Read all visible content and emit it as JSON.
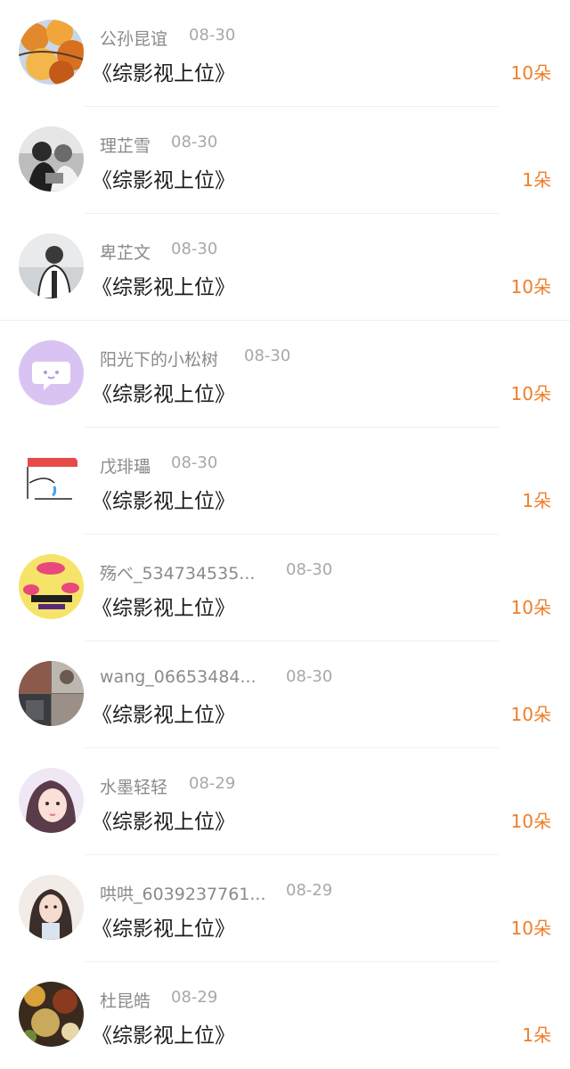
{
  "list": {
    "rows": [
      {
        "name": "公孙昆谊",
        "date": "08-30",
        "book": "《综影视上位》",
        "amount": "10朵",
        "avatar": "autumn-leaves-avatar"
      },
      {
        "name": "理芷雪",
        "date": "08-30",
        "book": "《综影视上位》",
        "amount": "1朵",
        "avatar": "monochrome-couple-avatar"
      },
      {
        "name": "卑芷文",
        "date": "08-30",
        "book": "《综影视上位》",
        "amount": "10朵",
        "avatar": "beach-boy-avatar"
      },
      {
        "name": "阳光下的小松树",
        "date": "08-30",
        "book": "《综影视上位》",
        "amount": "10朵",
        "avatar": "chat-bubble-avatar"
      },
      {
        "name": "戊琲瓃",
        "date": "08-30",
        "book": "《综影视上位》",
        "amount": "1朵",
        "avatar": "crying-cartoon-avatar"
      },
      {
        "name": "殇べ_534734535...",
        "date": "08-30",
        "book": "《综影视上位》",
        "amount": "10朵",
        "avatar": "love-kiss-avatar"
      },
      {
        "name": "wang_06653484...",
        "date": "08-30",
        "book": "《综影视上位》",
        "amount": "10朵",
        "avatar": "collage-photo-avatar"
      },
      {
        "name": "水墨轻轻",
        "date": "08-29",
        "book": "《综影视上位》",
        "amount": "10朵",
        "avatar": "anime-girl-avatar"
      },
      {
        "name": "哄哄_6039237761...",
        "date": "08-29",
        "book": "《综影视上位》",
        "amount": "10朵",
        "avatar": "girl-portrait-avatar"
      },
      {
        "name": "杜昆皓",
        "date": "08-29",
        "book": "《综影视上位》",
        "amount": "1朵",
        "avatar": "bokeh-lights-avatar"
      }
    ]
  }
}
